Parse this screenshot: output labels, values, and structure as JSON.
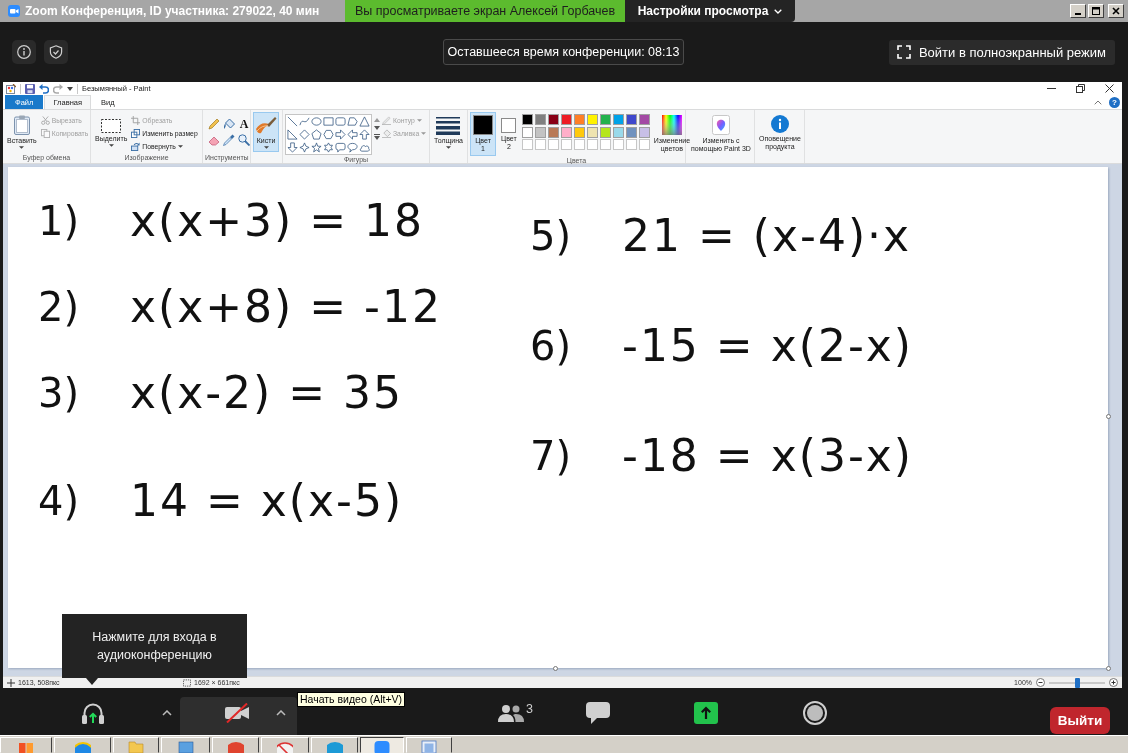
{
  "zoom_window": {
    "title": "Zoom Конференция, ID участника: 279022, 40 мин",
    "share_banner": "Вы просматриваете экран Алексей Горбачев",
    "view_options": "Настройки просмотра",
    "remaining_time": "Оставшееся время конференции: 08:13",
    "fullscreen": "Войти в полноэкранный режим"
  },
  "paint": {
    "title": "Безымянный - Paint",
    "tabs": [
      {
        "label": "Файл",
        "kind": "file",
        "selected": false
      },
      {
        "label": "Главная",
        "kind": "tab",
        "selected": true
      },
      {
        "label": "Вид",
        "kind": "tab",
        "selected": false
      }
    ],
    "help": "?",
    "ribbon": {
      "clipboard": {
        "label": "Буфер обмена",
        "paste": "Вставить",
        "actions": [
          {
            "label": "Вырезать",
            "disabled": true
          },
          {
            "label": "Копировать",
            "disabled": true
          }
        ]
      },
      "image": {
        "label": "Изображение",
        "select": "Выделить",
        "actions": [
          {
            "label": "Обрезать",
            "disabled": true,
            "dropdown": false
          },
          {
            "label": "Изменить размер",
            "disabled": false,
            "dropdown": false
          },
          {
            "label": "Повернуть",
            "disabled": false,
            "dropdown": true
          }
        ]
      },
      "tools": {
        "label": "Инструменты",
        "text_tool": "A"
      },
      "brushes": {
        "label": "Кисти",
        "selected": true
      },
      "shapes": {
        "label": "Фигуры",
        "options": [
          {
            "label": "Контур",
            "disabled": true
          },
          {
            "label": "Заливка",
            "disabled": true
          }
        ]
      },
      "size": {
        "label": "Толщина"
      },
      "colors": {
        "label": "Цвета",
        "slots": [
          {
            "label": "Цвет 1",
            "color": "#000000",
            "selected": true
          },
          {
            "label": "Цвет 2",
            "color": "#ffffff",
            "selected": false
          }
        ],
        "palette": [
          {
            "kind": "color",
            "color": "#000000"
          },
          {
            "kind": "color",
            "color": "#7f7f7f"
          },
          {
            "kind": "color",
            "color": "#880015"
          },
          {
            "kind": "color",
            "color": "#ed1c24"
          },
          {
            "kind": "color",
            "color": "#ff7f27"
          },
          {
            "kind": "color",
            "color": "#fff200"
          },
          {
            "kind": "color",
            "color": "#22b14c"
          },
          {
            "kind": "color",
            "color": "#00a2e8"
          },
          {
            "kind": "color",
            "color": "#3f48cc"
          },
          {
            "kind": "color",
            "color": "#a349a4"
          },
          {
            "kind": "color",
            "color": "#ffffff"
          },
          {
            "kind": "color",
            "color": "#c3c3c3"
          },
          {
            "kind": "color",
            "color": "#b97a57"
          },
          {
            "kind": "color",
            "color": "#ffaec9"
          },
          {
            "kind": "color",
            "color": "#ffc90e"
          },
          {
            "kind": "color",
            "color": "#efe4b0"
          },
          {
            "kind": "color",
            "color": "#b5e61d"
          },
          {
            "kind": "color",
            "color": "#99d9ea"
          },
          {
            "kind": "color",
            "color": "#7092be"
          },
          {
            "kind": "color",
            "color": "#c8bfe7"
          },
          {
            "kind": "empty"
          },
          {
            "kind": "empty"
          },
          {
            "kind": "empty"
          },
          {
            "kind": "empty"
          },
          {
            "kind": "empty"
          },
          {
            "kind": "empty"
          },
          {
            "kind": "empty"
          },
          {
            "kind": "empty"
          },
          {
            "kind": "empty"
          },
          {
            "kind": "empty"
          }
        ],
        "edit": "Изменение цветов"
      },
      "paint3d": "Изменить с помощью Paint 3D",
      "product_alert": "Оповещение продукта"
    },
    "canvas": {
      "left_column": [
        {
          "number": "1)",
          "expression": "x(x+3) = 18"
        },
        {
          "number": "2)",
          "expression": "x(x+8) = -12"
        },
        {
          "number": "3)",
          "expression": "x(x-2) = 35"
        },
        {
          "number": "4)",
          "expression": "14 = x(x-5)"
        }
      ],
      "right_column": [
        {
          "number": "5)",
          "expression": "21 = (x-4)·x"
        },
        {
          "number": "6)",
          "expression": "-15 = x(2-x)"
        },
        {
          "number": "7)",
          "expression": "-18 = x(3-x)"
        }
      ]
    },
    "status_bar": {
      "cursor_position": "1613, 508пкс",
      "image_size": "1692 × 661пкс",
      "zoom": "100%",
      "zoom_slider": {
        "level": 0.5
      }
    }
  },
  "audio_tooltip": "Нажмите для входа в аудиоконференцию",
  "video_tooltip": "Начать видео (Alt+V)",
  "meeting_controls": {
    "video": {
      "off": true,
      "hovered": true
    },
    "participants_count": "3",
    "leave": "Выйти"
  },
  "taskbar": [
    {
      "active": false
    },
    {
      "active": false
    },
    {
      "active": false
    },
    {
      "active": false
    },
    {
      "active": false
    },
    {
      "active": false
    },
    {
      "active": false
    },
    {
      "active": true
    },
    {
      "active": false
    }
  ]
}
